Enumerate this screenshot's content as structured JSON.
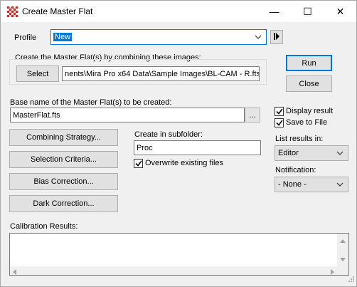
{
  "window": {
    "title": "Create Master Flat",
    "minimize_glyph": "—",
    "maximize_glyph": "☐",
    "close_glyph": "✕"
  },
  "profile": {
    "label": "Profile",
    "value": "New"
  },
  "combine": {
    "group_label": "Create the Master Flat(s) by combining these images:",
    "select_label": "Select",
    "path": "nents\\Mira Pro x64 Data\\Sample Images\\BL-CAM - R.fts"
  },
  "actions": {
    "run_label": "Run",
    "close_label": "Close"
  },
  "basename": {
    "label": "Base name of the Master Flat(s) to be created:",
    "value": "MasterFlat.fts",
    "browse_label": "..."
  },
  "options": {
    "display_result_label": "Display result",
    "display_result_checked": true,
    "save_to_file_label": "Save to File",
    "save_to_file_checked": true,
    "list_results_label": "List results in:",
    "list_results_value": "Editor",
    "notification_label": "Notification:",
    "notification_value": "- None -"
  },
  "buttons": {
    "combining_strategy": "Combining Strategy...",
    "selection_criteria": "Selection Criteria...",
    "bias_correction": "Bias Correction...",
    "dark_correction": "Dark Correction..."
  },
  "subfolder": {
    "label": "Create in subfolder:",
    "value": "Proc",
    "overwrite_label": "Overwrite existing files",
    "overwrite_checked": true
  },
  "results": {
    "label": "Calibration Results:",
    "text": ""
  },
  "colors": {
    "accent": "#0078d7",
    "selection": "#0078d7"
  },
  "icons": {
    "app": "app-grid-icon",
    "profile_next": "triangle-right-icon",
    "dropdown": "chevron-down-icon",
    "checkmark": "checkmark-icon"
  }
}
